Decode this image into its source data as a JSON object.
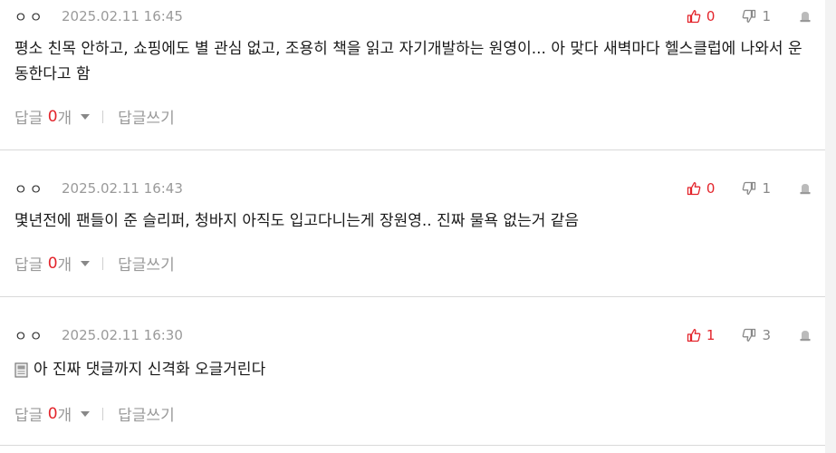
{
  "comments": [
    {
      "nick": "ㅇㅇ",
      "date": "2025.02.11 16:45",
      "likes": "0",
      "dislikes": "1",
      "text": "평소 친목 안하고, 쇼핑에도 별 관심 없고, 조용히 책을 읽고 자기개발하는 원영이... 아 맞다 새벽마다 헬스클럽에 나와서 운동한다고 함",
      "has_doc_icon": false,
      "reply_label": "답글",
      "reply_count": "0",
      "reply_unit": "개",
      "write_reply": "답글쓰기"
    },
    {
      "nick": "ㅇㅇ",
      "date": "2025.02.11 16:43",
      "likes": "0",
      "dislikes": "1",
      "text": "몇년전에 팬들이 준 슬리퍼, 청바지 아직도 입고다니는게 장원영.. 진짜 물욕 없는거 같음",
      "has_doc_icon": false,
      "reply_label": "답글",
      "reply_count": "0",
      "reply_unit": "개",
      "write_reply": "답글쓰기"
    },
    {
      "nick": "ㅇㅇ",
      "date": "2025.02.11 16:30",
      "likes": "1",
      "dislikes": "3",
      "text": "아 진짜 댓글까지 신격화 오글거린다",
      "has_doc_icon": true,
      "reply_label": "답글",
      "reply_count": "0",
      "reply_unit": "개",
      "write_reply": "답글쓰기"
    }
  ],
  "colors": {
    "accent": "#e3242b",
    "muted": "#9a9a9a",
    "divider": "#d9d9d9"
  }
}
